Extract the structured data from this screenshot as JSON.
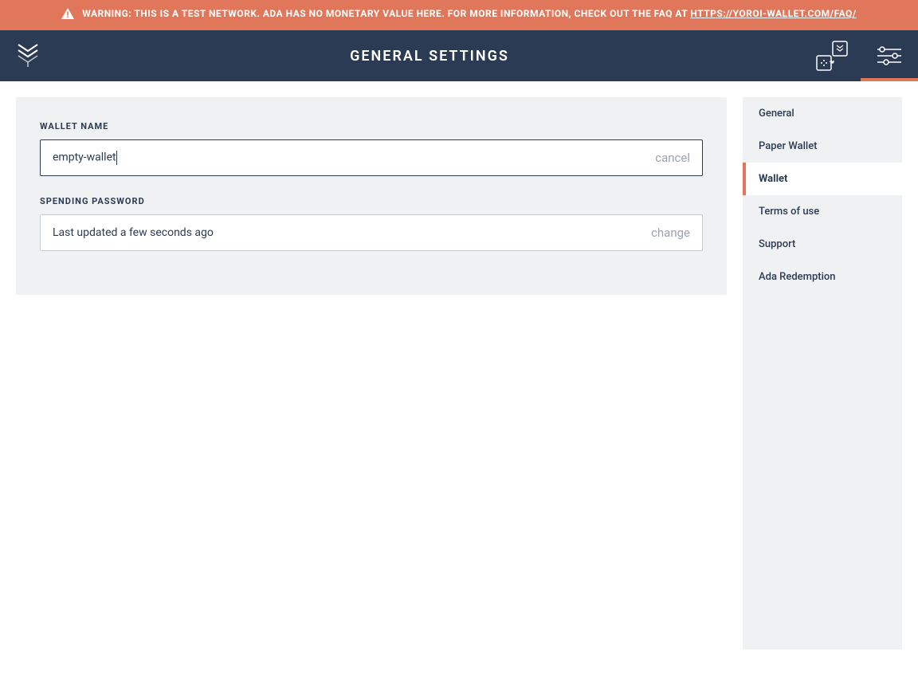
{
  "warning": {
    "text": "WARNING: THIS IS A TEST NETWORK. ADA HAS NO MONETARY VALUE HERE. FOR MORE INFORMATION, CHECK OUT THE FAQ AT ",
    "link_text": "HTTPS://YOROI-WALLET.COM/FAQ/"
  },
  "header": {
    "title": "GENERAL SETTINGS"
  },
  "main": {
    "wallet_name": {
      "label": "WALLET NAME",
      "value": "empty-wallet",
      "action": "cancel"
    },
    "spending_password": {
      "label": "SPENDING PASSWORD",
      "value": "Last updated a few seconds ago",
      "action": "change"
    }
  },
  "sidebar": {
    "items": [
      {
        "label": "General",
        "active": false
      },
      {
        "label": "Paper Wallet",
        "active": false
      },
      {
        "label": "Wallet",
        "active": true
      },
      {
        "label": "Terms of use",
        "active": false
      },
      {
        "label": "Support",
        "active": false
      },
      {
        "label": "Ada Redemption",
        "active": false
      }
    ]
  },
  "colors": {
    "accent": "#e0775a",
    "header_bg": "#2c3b54",
    "panel_bg": "#f0f1f3"
  }
}
